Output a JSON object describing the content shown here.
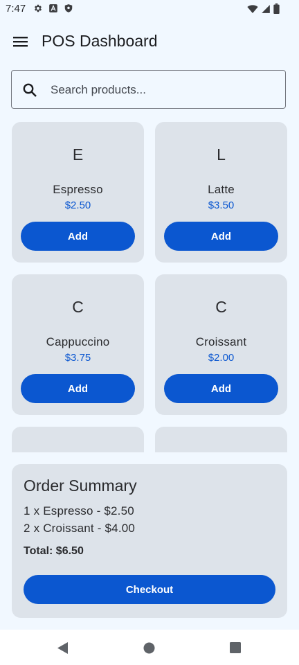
{
  "status_bar": {
    "time": "7:47",
    "left_icons": [
      "gear-icon",
      "a-icon",
      "shield-icon"
    ],
    "right_icons": [
      "wifi-icon",
      "signal-icon",
      "battery-icon"
    ]
  },
  "app_bar": {
    "menu_icon": "hamburger-menu-icon",
    "title": "POS Dashboard"
  },
  "search": {
    "icon": "search-icon",
    "placeholder": "Search products...",
    "value": ""
  },
  "products": [
    {
      "initial": "E",
      "name": "Espresso",
      "price": "$2.50",
      "button": "Add"
    },
    {
      "initial": "L",
      "name": "Latte",
      "price": "$3.50",
      "button": "Add"
    },
    {
      "initial": "C",
      "name": "Cappuccino",
      "price": "$3.75",
      "button": "Add"
    },
    {
      "initial": "C",
      "name": "Croissant",
      "price": "$2.00",
      "button": "Add"
    }
  ],
  "summary": {
    "title": "Order Summary",
    "items": [
      "1 x Espresso - $2.50",
      "2 x Croissant - $4.00"
    ],
    "total": "Total: $6.50",
    "checkout_label": "Checkout"
  },
  "nav_bar": {
    "icons": [
      "back-icon",
      "home-icon",
      "recents-icon"
    ]
  },
  "colors": {
    "background": "#f1f8ff",
    "card": "#dde3ea",
    "accent": "#0b57d0",
    "text": "#2a2b2e"
  }
}
